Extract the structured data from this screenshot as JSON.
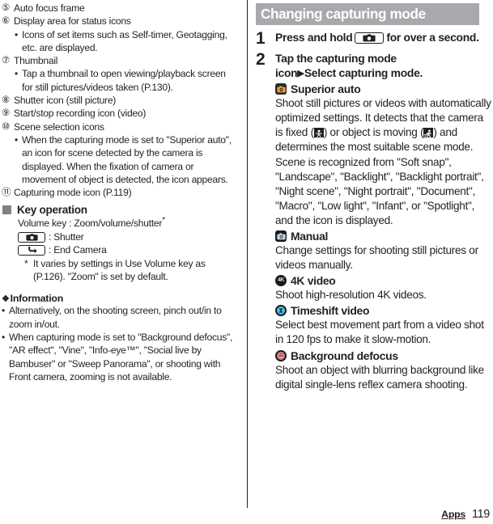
{
  "left_column": {
    "numbered_items": [
      {
        "marker": "⑤",
        "text": "Auto focus frame",
        "sub_bullets": []
      },
      {
        "marker": "⑥",
        "text": "Display area for status icons",
        "sub_bullets": [
          "Icons of set items such as Self-timer, Geotagging, etc. are displayed."
        ]
      },
      {
        "marker": "⑦",
        "text": "Thumbnail",
        "sub_bullets": [
          "Tap a thumbnail to open viewing/playback screen for still pictures/videos taken (P.130)."
        ]
      },
      {
        "marker": "⑧",
        "text": "Shutter icon (still picture)",
        "sub_bullets": []
      },
      {
        "marker": "⑨",
        "text": "Start/stop recording icon (video)",
        "sub_bullets": []
      },
      {
        "marker": "⑩",
        "text": "Scene selection icons",
        "sub_bullets": [
          "When the capturing mode is set to \"Superior auto\", an icon for scene detected by the camera is displayed. When the fixation of camera or movement of object is detected, the icon appears."
        ]
      },
      {
        "marker": "⑪",
        "text": "Capturing mode icon (P.119)",
        "sub_bullets": []
      }
    ],
    "key_operation": {
      "heading": "Key operation",
      "volume_line_prefix": "Volume key : Zoom/volume/shutter",
      "volume_line_asterisk": "*",
      "keys": [
        {
          "icon": "camera-shutter-icon",
          "label": ": Shutter"
        },
        {
          "icon": "back-arrow-icon",
          "label": ": End Camera"
        }
      ],
      "footnote_marker": "*",
      "footnote": "It varies by settings in Use Volume key as (P.126). \"Zoom\" is set by default."
    },
    "information": {
      "heading": "Information",
      "diamond": "❖",
      "bullets": [
        "Alternatively, on the shooting screen, pinch out/in to zoom in/out.",
        "When capturing mode is set to \"Background defocus\", \"AR effect\", \"Vine\", \"Info-eye™\", \"Social live by Bambuser\" or \"Sweep Panorama\", or shooting with Front camera, zooming is not available."
      ]
    }
  },
  "right_column": {
    "section_title": "Changing capturing mode",
    "steps": [
      {
        "number": "1",
        "text_before_key": "Press and hold",
        "key_icon": "camera-shutter-icon",
        "text_after_key": "for over a second."
      },
      {
        "number": "2",
        "line1": "Tap the capturing mode",
        "line2_before": "icon",
        "line2_arrow": "▶",
        "line2_after": "Select capturing mode."
      }
    ],
    "modes": [
      {
        "icon": "superior-auto-icon",
        "name": "Superior auto",
        "description_parts": [
          {
            "type": "text",
            "value": "Shoot still pictures or videos with automatically optimized settings."
          },
          {
            "type": "text",
            "value": "It detects that the camera is fixed ("
          },
          {
            "type": "icon",
            "value": "tripod-fixed-icon"
          },
          {
            "type": "text",
            "value": ") or object is moving ("
          },
          {
            "type": "icon",
            "value": "moving-object-icon"
          },
          {
            "type": "text",
            "value": ") and determines the most suitable scene mode."
          },
          {
            "type": "text",
            "value": "Scene is recognized from \"Soft snap\", \"Landscape\", \"Backlight\", \"Backlight portrait\", \"Night scene\", \"Night portrait\", \"Document\", \"Macro\", \"Low light\", \"Infant\", or \"Spotlight\", and the icon is displayed."
          }
        ]
      },
      {
        "icon": "manual-icon",
        "name": "Manual",
        "description": "Change settings for shooting still pictures or videos manually."
      },
      {
        "icon": "4k-video-icon",
        "name": "4K video",
        "description": "Shoot high-resolution 4K videos."
      },
      {
        "icon": "timeshift-video-icon",
        "name": "Timeshift video",
        "description": "Select best movement part from a video shot in 120 fps to make it slow-motion."
      },
      {
        "icon": "background-defocus-icon",
        "name": "Background defocus",
        "description": "Shoot an object with blurring background like digital single-lens reflex camera shooting."
      }
    ]
  },
  "footer": {
    "label": "Apps",
    "page_number": "119"
  },
  "colors": {
    "section_bar_bg": "#a7a9ac",
    "text": "#231f20",
    "bullet_square": "#808184",
    "superior_auto_accent": "#f0a22e",
    "timeshift_accent": "#4fc3e8",
    "bgdefocus_accent": "#e8808a"
  }
}
